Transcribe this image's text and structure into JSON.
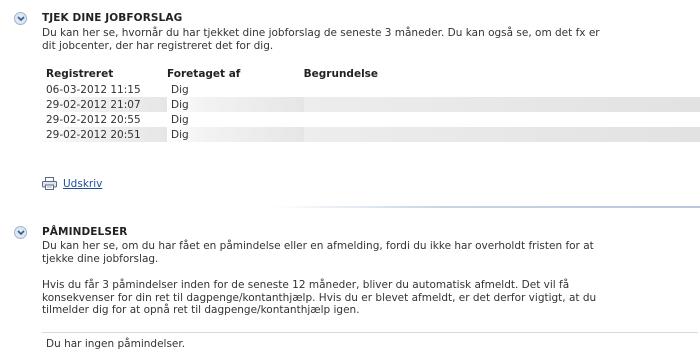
{
  "section1": {
    "title": "TJEK DINE JOBFORSLAG",
    "description_line1": "Du kan her se, hvornår du har tjekket dine jobforslag de seneste 3 måneder. Du kan også se, om det fx er",
    "description_line2": "dit jobcenter, der har registreret det for dig.",
    "columns": [
      "Registreret",
      "Foretaget af",
      "Begrundelse"
    ],
    "rows": [
      {
        "registered": "06-03-2012 11:15",
        "by": "Dig",
        "reason": ""
      },
      {
        "registered": "29-02-2012 21:07",
        "by": "Dig",
        "reason": ""
      },
      {
        "registered": "29-02-2012 20:55",
        "by": "Dig",
        "reason": ""
      },
      {
        "registered": "29-02-2012 20:51",
        "by": "Dig",
        "reason": ""
      }
    ],
    "print_label": "Udskriv"
  },
  "section2": {
    "title": "PÅMINDELSER",
    "para1_line1": "Du kan her se, om du har fået en påmindelse eller en afmelding, fordi du ikke har overholdt fristen for at",
    "para1_line2": "tjekke dine jobforslag.",
    "para2_line1": "Hvis du får 3 påmindelser inden for de seneste 12 måneder, bliver du automatisk afmeldt. Det vil få",
    "para2_line2": "konsekvenser for din ret til dagpenge/kontanthjælp. Hvis du er blevet afmeldt, er det derfor vigtigt, at du",
    "para2_line3": "tilmelder dig for at opnå ret til dagpenge/kontanthjælp igen.",
    "empty_message": "Du har ingen påmindelser."
  },
  "colors": {
    "link": "#1f4f9a",
    "divider": "#c8d5e4",
    "toggle_bg": "#dfe7f1"
  },
  "icons": {
    "toggle": "chevron-down-circle-icon",
    "print": "printer-icon"
  }
}
